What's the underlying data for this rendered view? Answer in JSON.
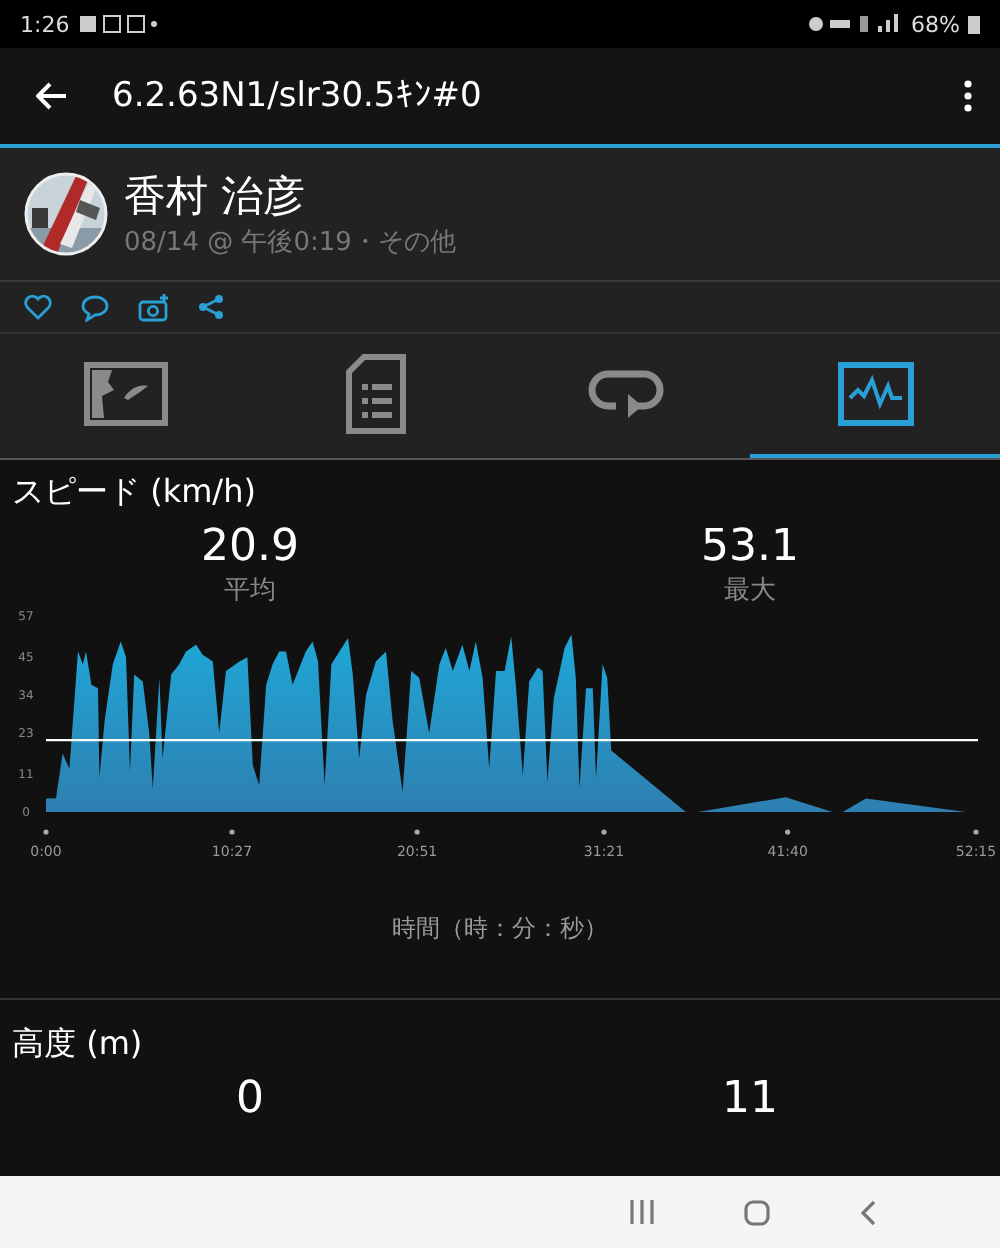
{
  "status_bar": {
    "time": "1:26",
    "battery": "68%"
  },
  "app_bar": {
    "title": "6.2.63N1/slr30.5ｷﾝ#0"
  },
  "activity": {
    "name": "香村 治彦",
    "meta": "08/14 @ 午後0:19・その他"
  },
  "tabs": [
    {
      "kind": "map",
      "selected": false
    },
    {
      "kind": "details",
      "selected": false
    },
    {
      "kind": "laps",
      "selected": false
    },
    {
      "kind": "charts",
      "selected": true
    }
  ],
  "speed": {
    "title": "スピード (km/h)",
    "stats": [
      {
        "value": "20.9",
        "label": "平均"
      },
      {
        "value": "53.1",
        "label": "最大"
      }
    ],
    "chart_data": {
      "type": "area",
      "xlabel": "時間（時：分：秒）",
      "ylim": [
        0,
        57
      ],
      "xlim": [
        0,
        3135
      ],
      "yticks": [
        0,
        11,
        23,
        34,
        45,
        57
      ],
      "xticks": [
        {
          "value": 0,
          "label": "0:00"
        },
        {
          "value": 627,
          "label": "10:27"
        },
        {
          "value": 1251,
          "label": "20:51"
        },
        {
          "value": 1881,
          "label": "31:21"
        },
        {
          "value": 2500,
          "label": "41:40"
        },
        {
          "value": 3135,
          "label": "52:15"
        }
      ],
      "x": [
        0,
        34,
        56,
        79,
        108,
        124,
        135,
        153,
        175,
        180,
        198,
        225,
        252,
        270,
        283,
        297,
        326,
        348,
        360,
        382,
        393,
        422,
        449,
        472,
        506,
        528,
        562,
        584,
        607,
        652,
        679,
        697,
        719,
        742,
        764,
        786,
        809,
        831,
        876,
        899,
        917,
        939,
        962,
        989,
        1018,
        1034,
        1056,
        1079,
        1112,
        1146,
        1168,
        1202,
        1231,
        1258,
        1292,
        1326,
        1348,
        1371,
        1404,
        1427,
        1449,
        1472,
        1494,
        1517,
        1546,
        1568,
        1584,
        1607,
        1629,
        1658,
        1674,
        1690,
        1712,
        1748,
        1771,
        1786,
        1798,
        1820,
        1843,
        1854,
        1876,
        1892,
        1905,
        2157,
        2198,
        2494,
        2651,
        2685,
        2764,
        3101,
        3135
      ],
      "series": [
        {
          "color": "#1ea8d8",
          "values": [
            3.9,
            4,
            17,
            12.6,
            46.7,
            43,
            46.7,
            37,
            36,
            10,
            27,
            43,
            49.6,
            45,
            11.7,
            40,
            38,
            23,
            6.8,
            39,
            15.6,
            40,
            43,
            46.7,
            48.6,
            45.7,
            43.8,
            23,
            41,
            43.8,
            45,
            13.6,
            7.8,
            37,
            43,
            46.7,
            46.7,
            37,
            46.7,
            49.6,
            43.8,
            7.8,
            43,
            46.7,
            50.6,
            40,
            15.6,
            34,
            43.8,
            46.7,
            27,
            5.8,
            41,
            39,
            23,
            43,
            47.7,
            41,
            48.6,
            41,
            49.6,
            39,
            12.6,
            41,
            41,
            51,
            37,
            10.7,
            38,
            42,
            41,
            8.8,
            33,
            47.7,
            51.6,
            39,
            6.8,
            36,
            36,
            9.7,
            43,
            39,
            17.9,
            0,
            0,
            4.3,
            0,
            0,
            3.9,
            0,
            0
          ]
        }
      ],
      "ref_lines": [
        {
          "axis": "y",
          "value": 20.9
        }
      ]
    }
  },
  "altitude": {
    "title": "高度 (m)",
    "stats": [
      {
        "value": "0"
      },
      {
        "value": "11"
      }
    ]
  }
}
